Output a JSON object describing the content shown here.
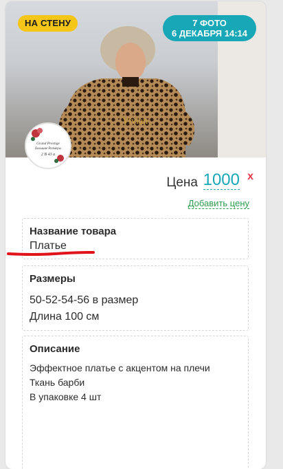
{
  "badges": {
    "wall": "НА СТЕНУ",
    "photos_count": "7 ФОТО",
    "date": "6 ДЕКАБРЯ 14:14"
  },
  "avatar": {
    "line1": "Grand Prestige",
    "line2": "Большие Размеры",
    "line3": "2 В 43 а"
  },
  "price": {
    "label": "Цена",
    "value": "1000",
    "remove_label": "x"
  },
  "add_price_label": "Добавить цену",
  "fields": {
    "name": {
      "title": "Название товара",
      "value": "Платье"
    },
    "sizes": {
      "title": "Размеры",
      "line1": "50-52-54-56 в размер",
      "line2": "Длина 100 см"
    },
    "description": {
      "title": "Описание",
      "line1": "Эффектное платье с акцентом на плечи",
      "line2": "Ткань барби",
      "line3": "В упаковке 4 шт"
    }
  },
  "colors": {
    "accent": "#17a7b6",
    "badge_yellow": "#f5c518",
    "link_green": "#2e9b4d",
    "remove_red": "#e8384f",
    "annotation_red": "#e0121a"
  }
}
